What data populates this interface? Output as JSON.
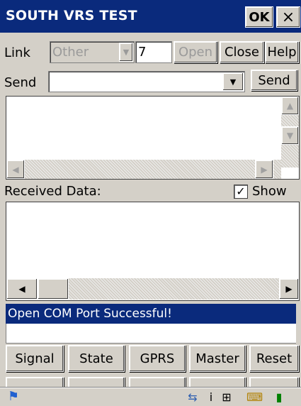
{
  "window": {
    "title": "SOUTH VRS TEST",
    "ok_label": "OK",
    "close_glyph": "×"
  },
  "link_row": {
    "label": "Link",
    "link_type": "Other",
    "port": "7",
    "open_label": "Open",
    "close_label": "Close",
    "help_label": "Help"
  },
  "send_row": {
    "label": "Send",
    "value": "",
    "send_label": "Send"
  },
  "received": {
    "label": "Received Data:",
    "show_label": "Show",
    "show_checked": true
  },
  "status": {
    "message": "Open COM Port Successful!"
  },
  "buttons": {
    "row1": [
      "Signal",
      "State",
      "GPRS",
      "Master",
      "Reset"
    ],
    "row2": [
      "",
      "",
      "",
      "",
      ""
    ]
  },
  "icons": {
    "start": "windows-flag-icon",
    "tray": [
      "network-icon",
      "info-icon",
      "connection-icon",
      "keyboard-icon",
      "battery-icon"
    ]
  },
  "colors": {
    "title_bar": "#0a2a7c",
    "status_highlight": "#0a2a7c",
    "chrome": "#d4d0c8"
  }
}
